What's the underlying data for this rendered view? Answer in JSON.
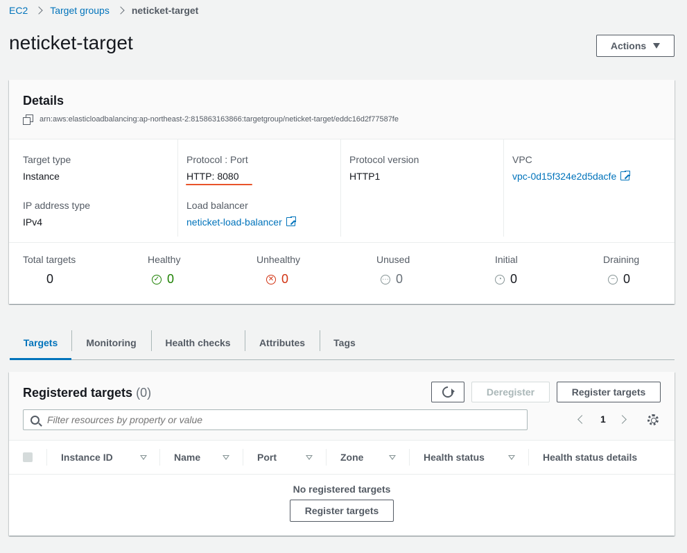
{
  "breadcrumb": {
    "root": "EC2",
    "parent": "Target groups",
    "current": "neticket-target"
  },
  "page": {
    "title": "neticket-target",
    "actions_label": "Actions"
  },
  "details": {
    "title": "Details",
    "arn": "arn:aws:elasticloadbalancing:ap-northeast-2:815863163866:targetgroup/neticket-target/eddc16d2f77587fe",
    "target_type": {
      "label": "Target type",
      "value": "Instance"
    },
    "ip_address_type": {
      "label": "IP address type",
      "value": "IPv4"
    },
    "protocol_port": {
      "label": "Protocol : Port",
      "value": "HTTP: 8080"
    },
    "load_balancer": {
      "label": "Load balancer",
      "value": "neticket-load-balancer"
    },
    "protocol_version": {
      "label": "Protocol version",
      "value": "HTTP1"
    },
    "vpc": {
      "label": "VPC",
      "value": "vpc-0d15f324e2d5dacfe"
    }
  },
  "counts": {
    "total": {
      "label": "Total targets",
      "value": "0"
    },
    "healthy": {
      "label": "Healthy",
      "value": "0",
      "color": "#1d8102"
    },
    "unhealthy": {
      "label": "Unhealthy",
      "value": "0",
      "color": "#d13212"
    },
    "unused": {
      "label": "Unused",
      "value": "0"
    },
    "initial": {
      "label": "Initial",
      "value": "0"
    },
    "draining": {
      "label": "Draining",
      "value": "0"
    }
  },
  "tabs": [
    "Targets",
    "Monitoring",
    "Health checks",
    "Attributes",
    "Tags"
  ],
  "targets": {
    "title": "Registered targets",
    "count": "(0)",
    "deregister_label": "Deregister",
    "register_label": "Register targets",
    "filter_placeholder": "Filter resources by property or value",
    "page": "1",
    "columns": [
      "Instance ID",
      "Name",
      "Port",
      "Zone",
      "Health status",
      "Health status details"
    ],
    "empty_text": "No registered targets",
    "empty_button": "Register targets"
  },
  "colors": {
    "accent": "#0073bb",
    "healthy": "#1d8102",
    "unhealthy": "#d13212",
    "highlight_underline": "#e8542a"
  }
}
